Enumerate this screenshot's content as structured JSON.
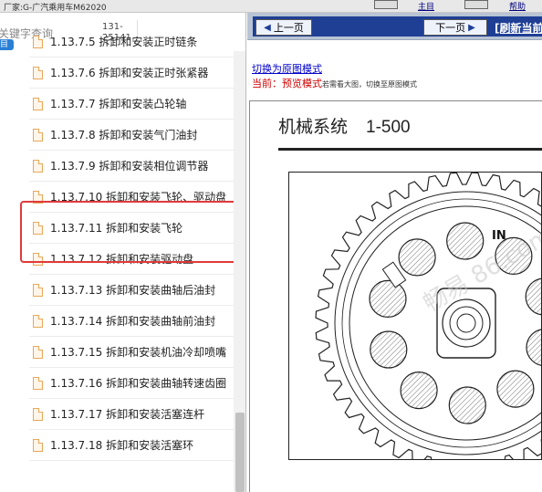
{
  "top": {
    "manufacturer": "厂家:G-广汽乘用车M62020",
    "link_a": "主目",
    "link_b": "帮助"
  },
  "left": {
    "search_label": "关键字查询",
    "search_chip": "目",
    "count": "131-25141",
    "items": [
      "1.13.7.5 拆卸和安装正时链条",
      "1.13.7.6 拆卸和安装正时张紧器",
      "1.13.7.7 拆卸和安装凸轮轴",
      "1.13.7.8 拆卸和安装气门油封",
      "1.13.7.9 拆卸和安装相位调节器",
      "1.13.7.10 拆卸和安装飞轮、驱动盘",
      "1.13.7.11 拆卸和安装飞轮",
      "1.13.7.12 拆卸和安装驱动盘",
      "1.13.7.13 拆卸和安装曲轴后油封",
      "1.13.7.14 拆卸和安装曲轴前油封",
      "1.13.7.15 拆卸和安装机油冷却喷嘴",
      "1.13.7.16 拆卸和安装曲轴转速齿圈",
      "1.13.7.17 拆卸和安装活塞连杆",
      "1.13.7.18 拆卸和安装活塞环"
    ]
  },
  "right": {
    "prev_label": "上一页",
    "next_label": "下一页",
    "refresh_label": "[刷新当前",
    "mode_link": "切换为原图模式",
    "current_label": "当前：",
    "current_mode": "预览模式",
    "current_hint": "若需看大图，切换至原图模式",
    "doc_title": "机械系统",
    "doc_page": "1-500",
    "diagram_label": "IN",
    "watermark": "畅易 86.com"
  },
  "colors": {
    "nav_blue": "#1f3f95",
    "highlight": "#e03a3a",
    "link_blue": "#0000cc",
    "current_red": "#cc0000"
  }
}
